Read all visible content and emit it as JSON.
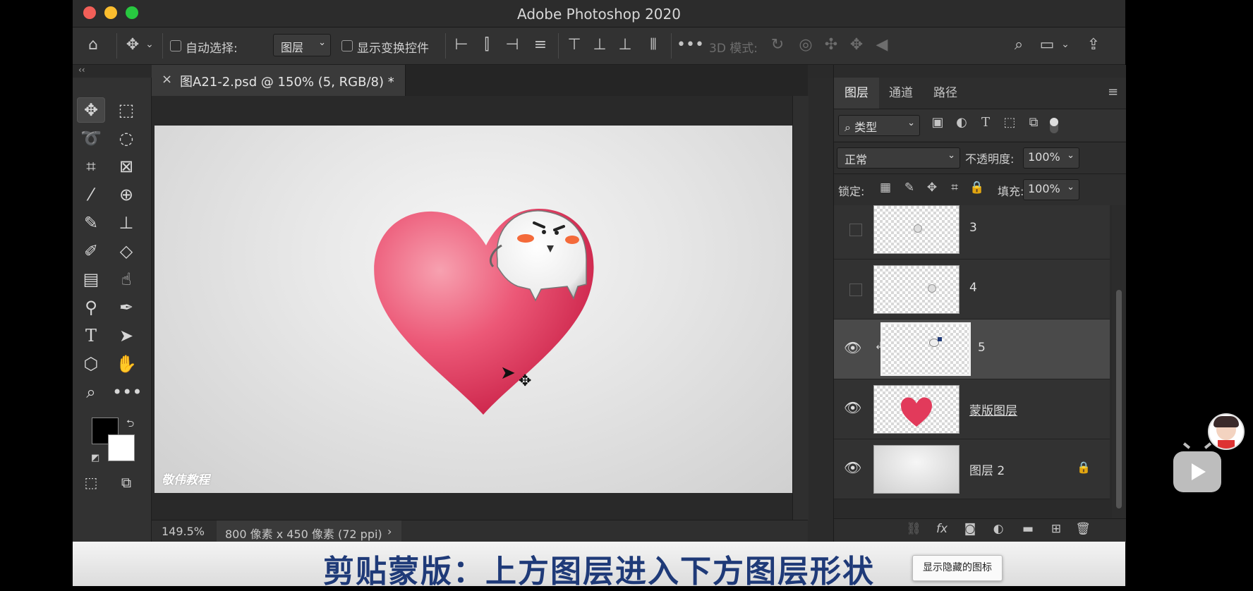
{
  "window": {
    "title": "Adobe Photoshop 2020",
    "traffic_colors": [
      "#f25f58",
      "#fbbd2e",
      "#28c840"
    ]
  },
  "options_bar": {
    "auto_select_label": "自动选择:",
    "auto_select_value": "图层",
    "show_transform_label": "显示变换控件",
    "mode_3d_label": "3D 模式:"
  },
  "document": {
    "tab_title": "图A21-2.psd @ 150% (5, RGB/8) *",
    "watermark": "敬伟教程",
    "zoom": "149.5%",
    "dimensions": "800 像素 x 450 像素 (72 ppi)"
  },
  "panels": {
    "tabs": [
      "图层",
      "通道",
      "路径"
    ],
    "active_tab": "图层",
    "filter_label": "类型",
    "blend_mode": "正常",
    "opacity_label": "不透明度:",
    "opacity_value": "100%",
    "lock_label": "锁定:",
    "fill_label": "填充:",
    "fill_value": "100%"
  },
  "layers": [
    {
      "name": "3",
      "visible": false,
      "selected": false,
      "clipped": false,
      "locked": false
    },
    {
      "name": "4",
      "visible": false,
      "selected": false,
      "clipped": false,
      "locked": false
    },
    {
      "name": "5",
      "visible": true,
      "selected": true,
      "clipped": true,
      "locked": false
    },
    {
      "name": "蒙版图层",
      "visible": true,
      "selected": false,
      "clipped": false,
      "locked": false
    },
    {
      "name": "图层 2",
      "visible": true,
      "selected": false,
      "clipped": false,
      "locked": true
    }
  ],
  "caption": "剪贴蒙版：上方图层进入下方图层形状",
  "tooltip": "显示隐藏的图标",
  "colors": {
    "caption_text": "#1f3a78",
    "heart": "#e23a5b",
    "foreground": "#000000",
    "background": "#ffffff"
  }
}
